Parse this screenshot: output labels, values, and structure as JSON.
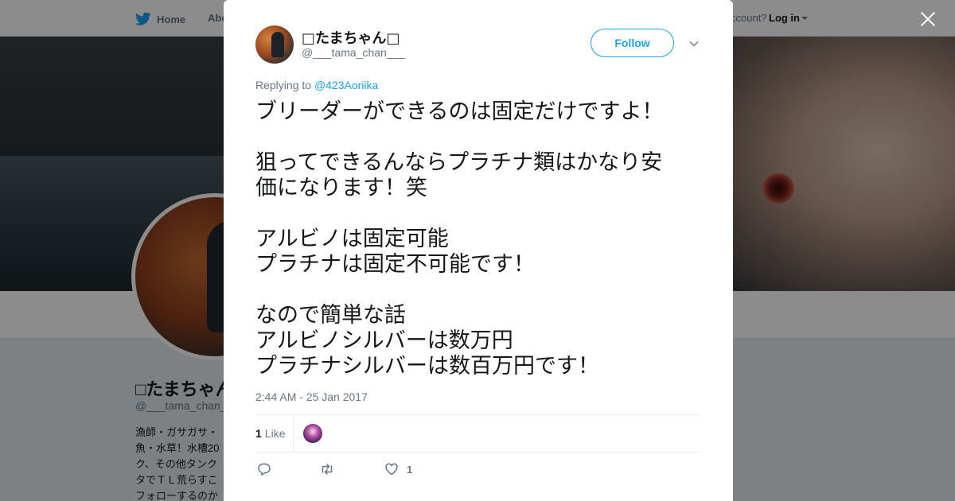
{
  "background": {
    "nav": {
      "home_label": "Home",
      "about_label": "Abo",
      "account_prompt": "ccount?",
      "login_label": "Log in"
    },
    "profile": {
      "name": "□たまちゃん",
      "handle": "@___tama_chan_",
      "bio": "漁師・ガサガサ・\n魚・水草！水槽20\nク、その他タンク\nタでＴＬ荒らすこ\nフォローするのか"
    }
  },
  "tweet": {
    "author_name": "□たまちゃん□",
    "author_handle": "@___tama_chan___",
    "follow_label": "Follow",
    "replying_prefix": "Replying to",
    "replying_to": "@423Aoriika",
    "text": "ブリーダーができるのは固定だけですよ！\n\n狙ってできるんならプラチナ類はかなり安\n価になります！笑\n\nアルビノは固定可能\nプラチナは固定不可能です！\n\nなので簡単な話\nアルビノシルバーは数万円\nプラチナシルバーは数百万円です！",
    "timestamp": "2:44 AM - 25 Jan 2017",
    "like_count": "1",
    "like_label": "Like",
    "action_like_count": "1"
  },
  "colors": {
    "accent": "#1da1f2",
    "secondary_text": "#657786",
    "primary_text": "#14171a"
  },
  "icons": {
    "nav_home": "twitter-bird-icon",
    "close": "close-icon",
    "more": "chevron-down-icon",
    "reply": "reply-icon",
    "retweet": "retweet-icon",
    "like": "heart-icon"
  }
}
